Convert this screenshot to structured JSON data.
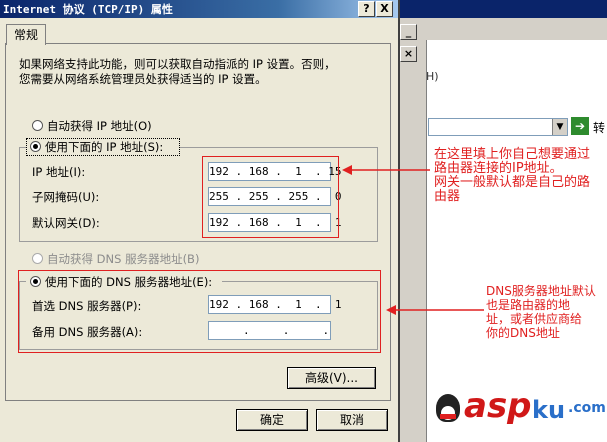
{
  "dialog": {
    "title": "Internet 协议 (TCP/IP) 属性",
    "help_btn": "?",
    "close_btn": "X",
    "tab_general": "常规",
    "description_line1": "如果网络支持此功能，则可以获取自动指派的 IP 设置。否则，",
    "description_line2": "您需要从网络系统管理员处获得适当的 IP 设置。",
    "auto_ip_label": "自动获得 IP 地址(O)",
    "manual_ip_label": "使用下面的 IP 地址(S):",
    "ip_label": "IP 地址(I):",
    "ip_value": "192 . 168 .  1  . 15",
    "subnet_label": "子网掩码(U):",
    "subnet_value": "255 . 255 . 255 .  0",
    "gateway_label": "默认网关(D):",
    "gateway_value": "192 . 168 .  1  .  1",
    "auto_dns_label": "自动获得 DNS 服务器地址(B)",
    "manual_dns_label": "使用下面的 DNS 服务器地址(E):",
    "pref_dns_label": "首选 DNS 服务器(P):",
    "pref_dns_value": "192 . 168 .  1  .  1",
    "alt_dns_label": "备用 DNS 服务器(A):",
    "alt_dns_value": "     .     .     .",
    "advanced_btn": "高级(V)...",
    "ok_btn": "确定",
    "cancel_btn": "取消"
  },
  "background_window": {
    "menu_fragment": "H)",
    "go_label": "转"
  },
  "annotations": {
    "ip_note_line1": "在这里填上你自己想要通过",
    "ip_note_line2": "路由器连接的IP地址。",
    "ip_note_line3": "网关一般默认都是自己的路",
    "ip_note_line4": "由器",
    "dns_note_line1": "DNS服务器地址默认",
    "dns_note_line2": "也是路由器的地",
    "dns_note_line3": "址，或者供应商给",
    "dns_note_line4": "你的DNS地址"
  },
  "watermark": {
    "brand": "asp",
    "suffix": "ku",
    "tld": ".com"
  },
  "colors": {
    "annotation_red": "#e02020",
    "titlebar_blue": "#0a246a"
  }
}
